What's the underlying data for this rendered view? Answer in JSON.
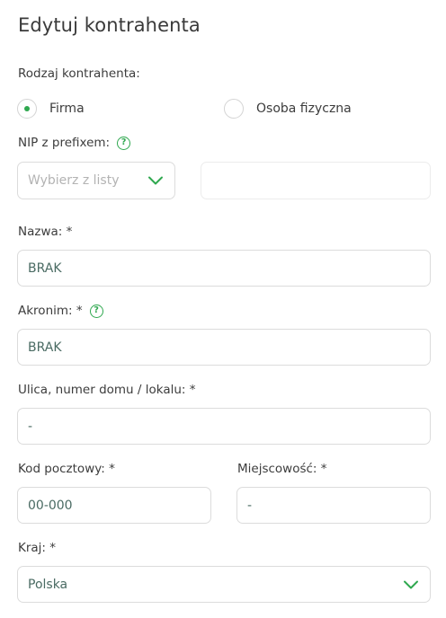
{
  "title": "Edytuj kontrahenta",
  "contractor_type": {
    "label": "Rodzaj kontrahenta:",
    "options": [
      "Firma",
      "Osoba fizyczna"
    ],
    "selected": "Firma"
  },
  "nip": {
    "label": "NIP z prefixem:",
    "prefix_placeholder": "Wybierz z listy",
    "value": ""
  },
  "name": {
    "label": "Nazwa: *",
    "value": "BRAK"
  },
  "acronym": {
    "label": "Akronim: *",
    "value": "BRAK"
  },
  "street": {
    "label": "Ulica, numer domu / lokalu: *",
    "value": "-"
  },
  "postal_code": {
    "label": "Kod pocztowy: *",
    "value": "00-000"
  },
  "city": {
    "label": "Miejscowość: *",
    "value": "-"
  },
  "country": {
    "label": "Kraj: *",
    "value": "Polska"
  },
  "colors": {
    "accent": "#2fa84f",
    "border": "#dcdcdc",
    "value_text": "#4a6b63"
  },
  "icons": {
    "help": "question-circle-icon",
    "dropdown": "chevron-down-icon"
  }
}
